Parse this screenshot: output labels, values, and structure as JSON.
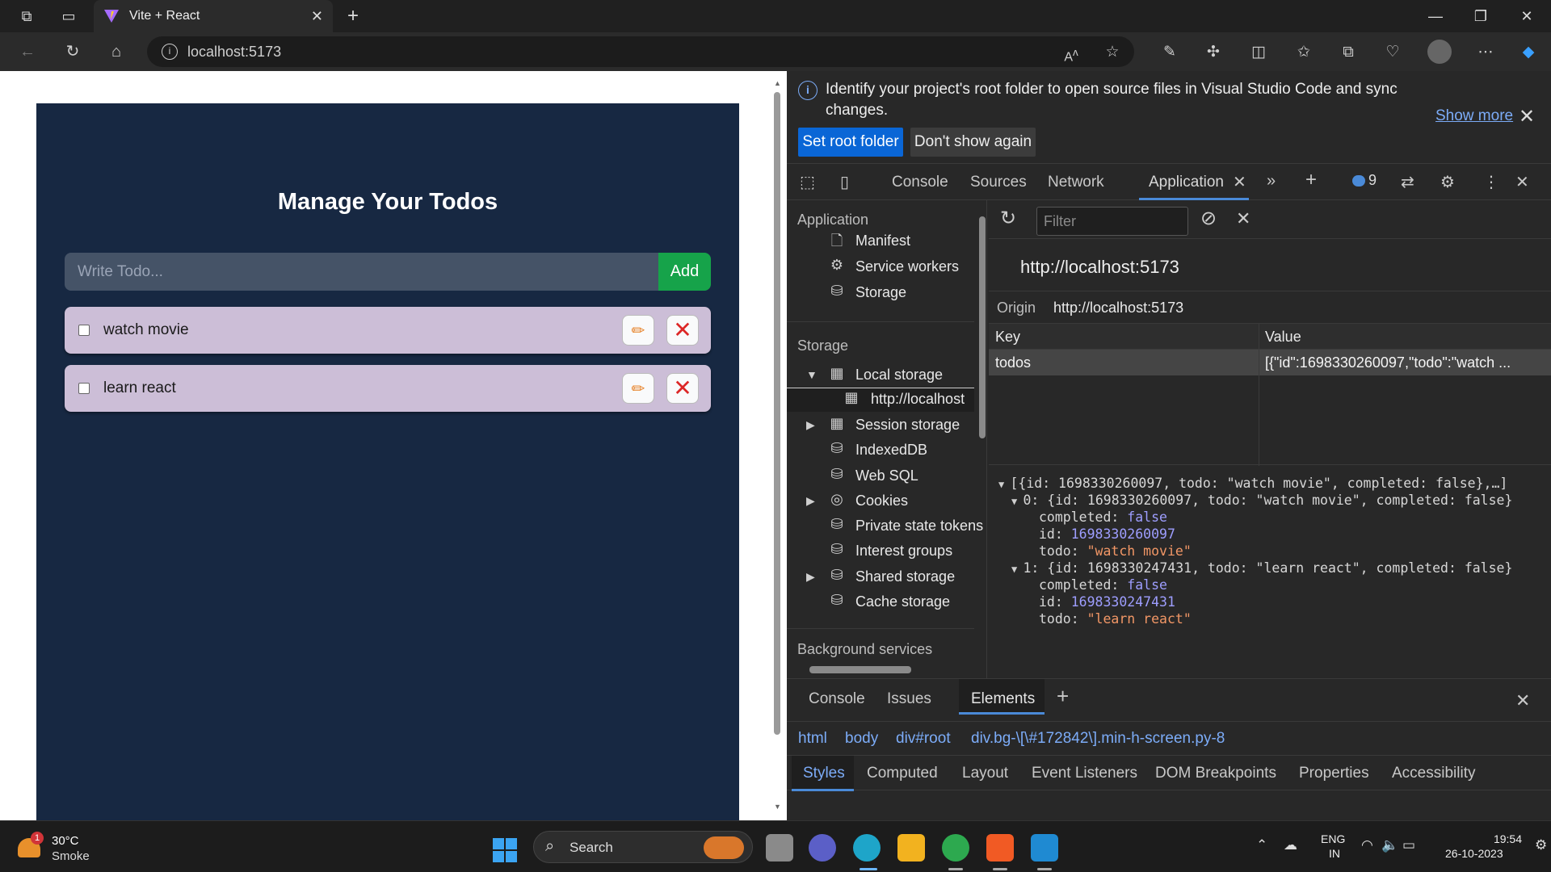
{
  "browser": {
    "tab_title": "Vite + React",
    "url": "localhost:5173"
  },
  "app": {
    "title": "Manage Your Todos",
    "input_placeholder": "Write Todo...",
    "add_label": "Add",
    "todos": [
      {
        "text": "watch movie",
        "completed": false
      },
      {
        "text": "learn react",
        "completed": false
      }
    ]
  },
  "devtools": {
    "banner_message": "Identify your project's root folder to open source files in Visual Studio Code and sync changes.",
    "show_more": "Show more",
    "set_root": "Set root folder",
    "dont_show": "Don't show again",
    "tabs": [
      "Console",
      "Sources",
      "Network",
      "Application"
    ],
    "issues_count": "9",
    "sidebar": {
      "application_header": "Application",
      "application_items": [
        "Manifest",
        "Service workers",
        "Storage"
      ],
      "storage_header": "Storage",
      "storage_items": [
        "Local storage",
        "http://localhost",
        "Session storage",
        "IndexedDB",
        "Web SQL",
        "Cookies",
        "Private state tokens",
        "Interest groups",
        "Shared storage",
        "Cache storage"
      ],
      "background_header": "Background services"
    },
    "filter_placeholder": "Filter",
    "origin_title": "http://localhost:5173",
    "origin_label": "Origin",
    "origin_value": "http://localhost:5173",
    "table": {
      "key_header": "Key",
      "value_header": "Value",
      "row_key": "todos",
      "row_value": "[{\"id\":1698330260097,\"todo\":\"watch ..."
    },
    "preview": {
      "root": "[{id: 1698330260097, todo: \"watch movie\", completed: false},…]",
      "item0_head": "0: {id: 1698330260097, todo: \"watch movie\", completed: false}",
      "item1_head": "1: {id: 1698330247431, todo: \"learn react\", completed: false}",
      "completed_key": "completed: ",
      "false_val": "false",
      "id_key": "id: ",
      "todo_key": "todo: ",
      "id0": "1698330260097",
      "todo0": "\"watch movie\"",
      "id1": "1698330247431",
      "todo1": "\"learn react\""
    },
    "drawer_tabs": [
      "Console",
      "Issues",
      "Elements"
    ],
    "breadcrumbs": [
      "html",
      "body",
      "div#root",
      "div.bg-\\[\\#172842\\].min-h-screen.py-8"
    ],
    "style_tabs": [
      "Styles",
      "Computed",
      "Layout",
      "Event Listeners",
      "DOM Breakpoints",
      "Properties",
      "Accessibility"
    ]
  },
  "taskbar": {
    "temperature": "30°C",
    "condition": "Smoke",
    "alert_count": "1",
    "search_label": "Search",
    "lang_top": "ENG",
    "lang_bottom": "IN",
    "time": "19:54",
    "date": "26-10-2023"
  },
  "colors": {
    "app_bg": "#172842",
    "todo_bg": "#ccbed7",
    "add_button": "#16a34a",
    "accent_blue": "#0a66d6"
  }
}
